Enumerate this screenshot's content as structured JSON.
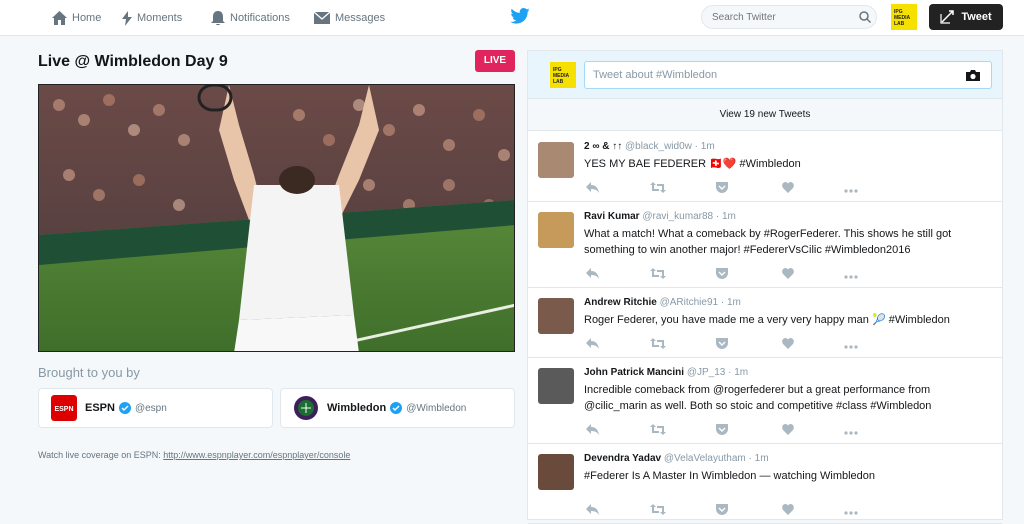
{
  "nav": {
    "home": "Home",
    "moments": "Moments",
    "notifications": "Notifications",
    "messages": "Messages",
    "search_placeholder": "Search Twitter",
    "tweet_button": "Tweet",
    "avatar_text": "IPG MEDIA LAB"
  },
  "event": {
    "title": "Live @ Wimbledon Day 9",
    "live_badge": "LIVE",
    "brought_by": "Brought to you by",
    "sponsors": [
      {
        "name": "ESPN",
        "handle": "@espn"
      },
      {
        "name": "Wimbledon",
        "handle": "@Wimbledon"
      }
    ],
    "watch_text": "Watch live coverage on ESPN: ",
    "watch_link": "http://www.espnplayer.com/espnplayer/console"
  },
  "compose": {
    "placeholder": "Tweet about #Wimbledon",
    "avatar_text": "IPG MEDIA LAB"
  },
  "new_tweets": "View 19 new Tweets",
  "tweets": [
    {
      "name": "2 ∞ & ↑↑",
      "handle": "@black_wid0w",
      "time": "· 1m",
      "text": "YES MY BAE FEDERER 🇨🇭❤️ #Wimbledon"
    },
    {
      "name": "Ravi Kumar",
      "handle": "@ravi_kumar88",
      "time": "· 1m",
      "text": "What a match! What a comeback by #RogerFederer. This shows he still got something to win another major! #FedererVsCilic #Wimbledon2016"
    },
    {
      "name": "Andrew Ritchie",
      "handle": "@ARitchie91",
      "time": "· 1m",
      "text": "Roger Federer, you have made me a very very happy man 🎾 #Wimbledon"
    },
    {
      "name": "John Patrick Mancini",
      "handle": "@JP_13",
      "time": "· 1m",
      "text": "Incredible comeback from @rogerfederer but a great performance from @cilic_marin as well. Both so stoic and competitive #class #Wimbledon"
    },
    {
      "name": "Devendra Yadav",
      "handle": "@VelaVelayutham",
      "time": "· 1m",
      "text": "#Federer Is A Master In Wimbledon — watching Wimbledon"
    }
  ],
  "colors": {
    "accent": "#1da1f2",
    "live": "#e0245e",
    "text": "#14171a",
    "muted": "#8899a6"
  }
}
